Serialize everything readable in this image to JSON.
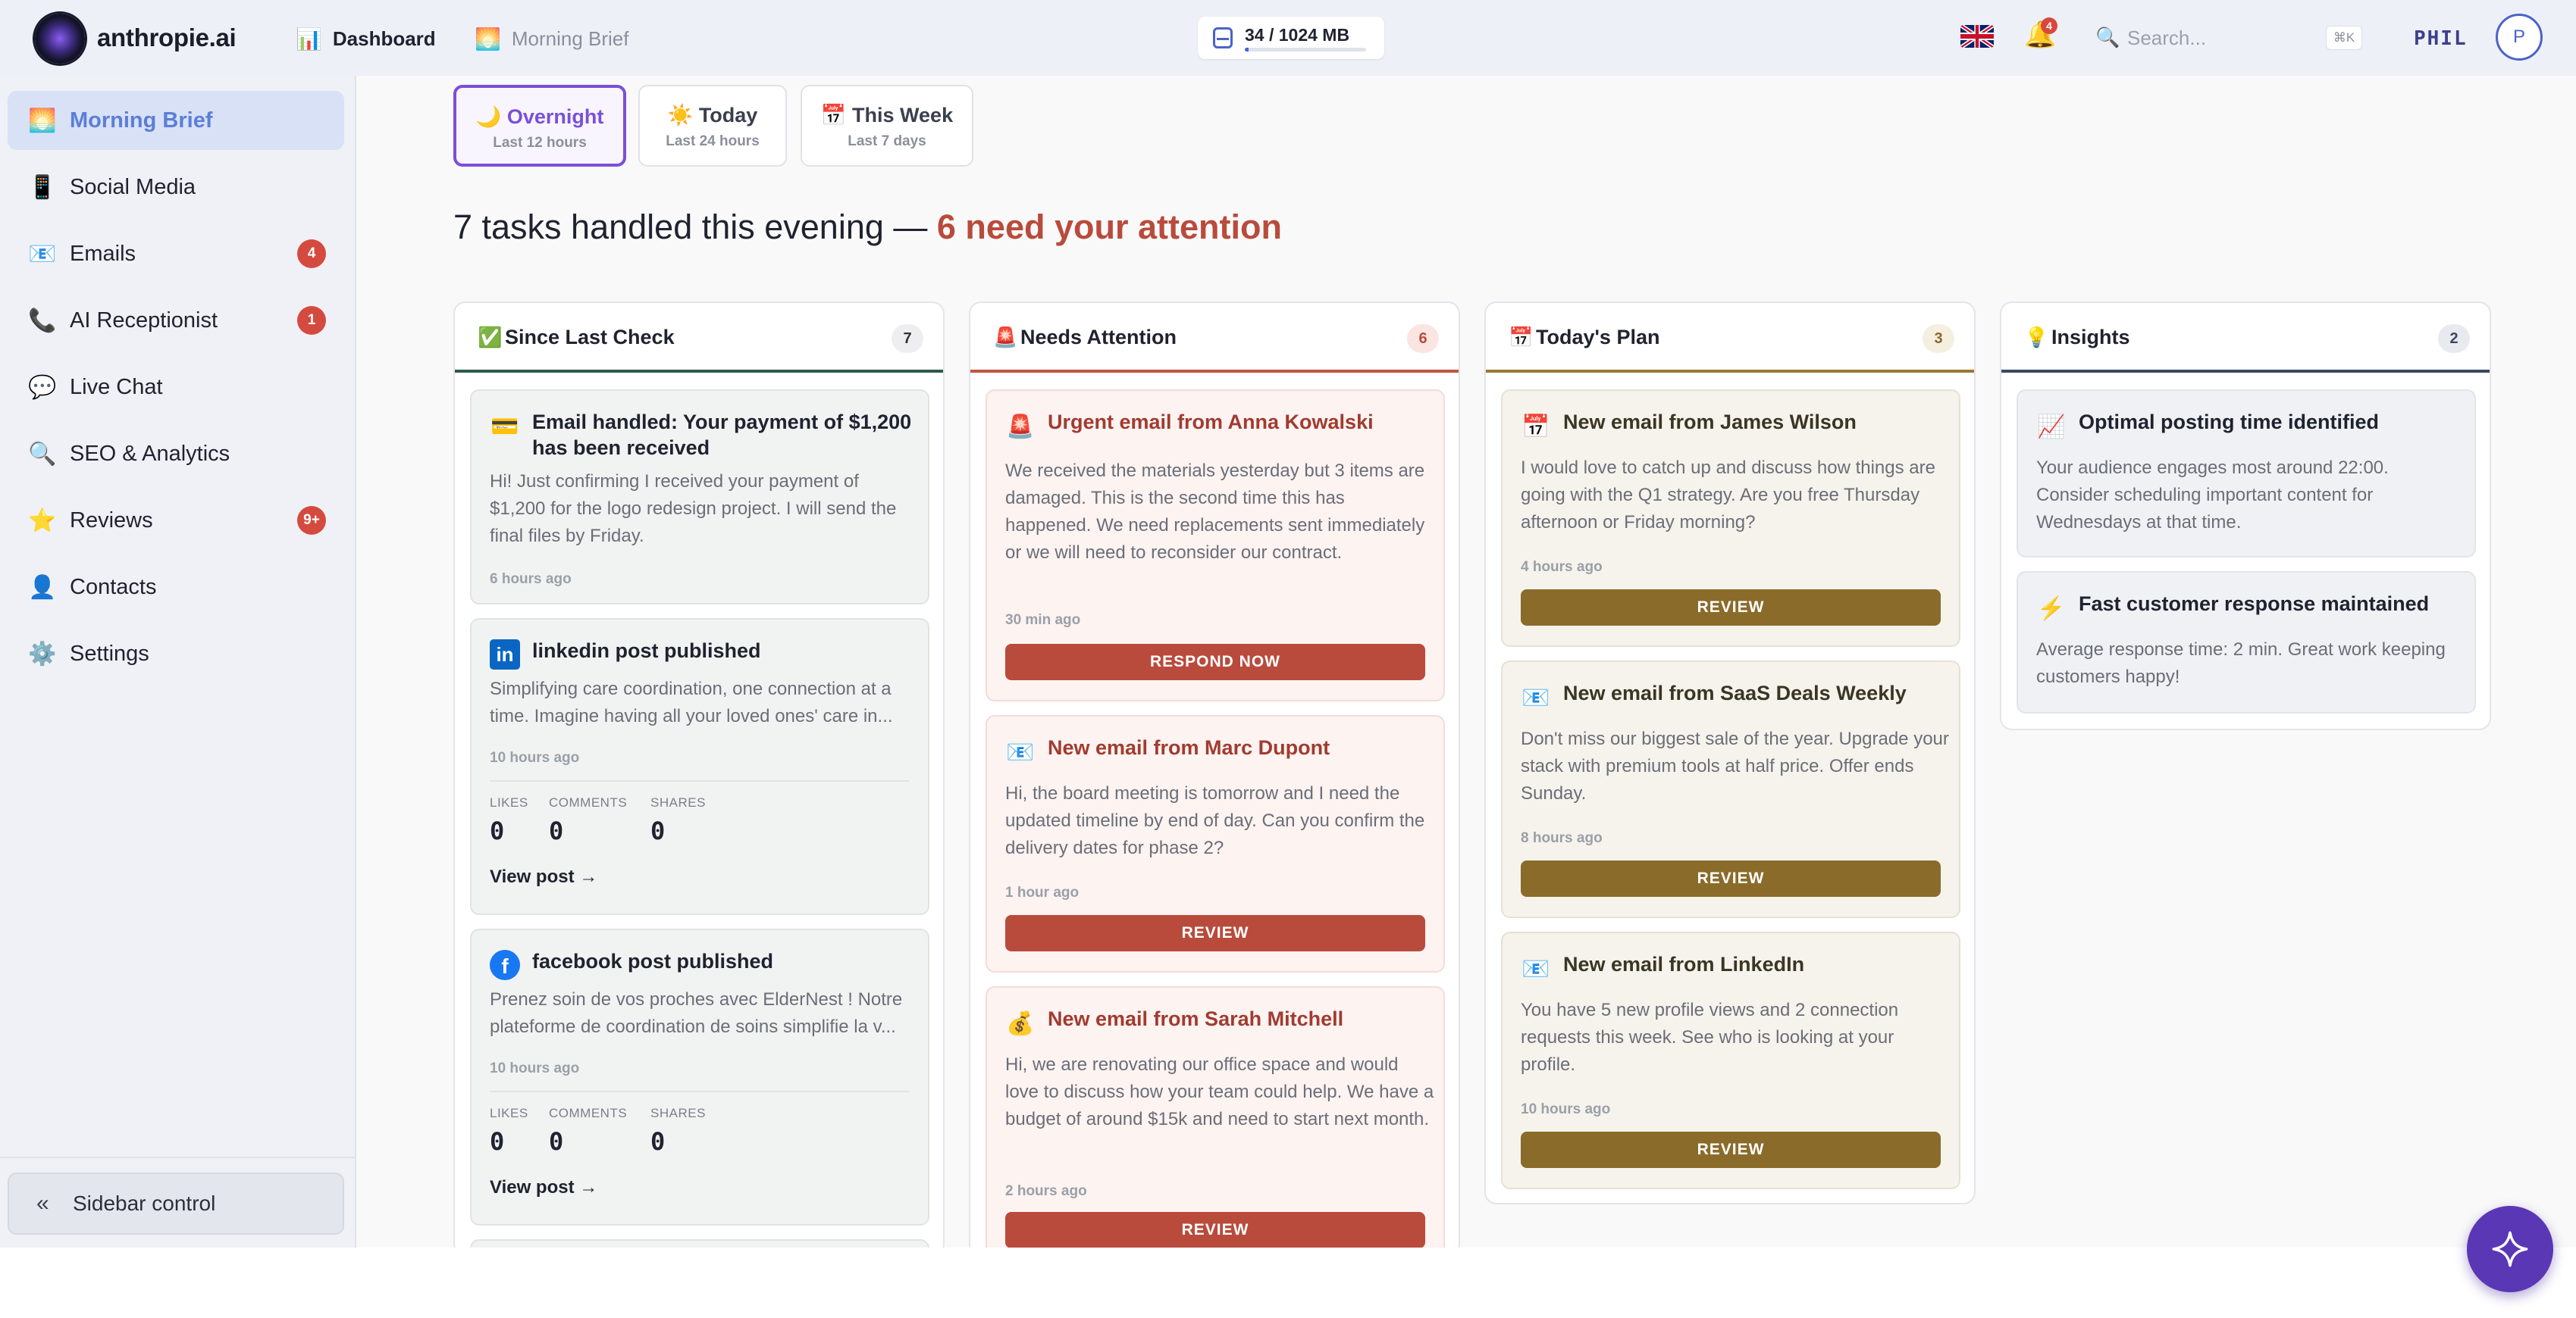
{
  "header": {
    "app_name": "anthropie.ai",
    "nav": [
      {
        "icon": "bar-chart-icon",
        "glyph": "📊",
        "label": "Dashboard"
      },
      {
        "icon": "sunrise-icon",
        "glyph": "🌅",
        "label": "Morning Brief"
      }
    ],
    "storage": {
      "label": "34 / 1024 MB",
      "used_fraction": 0.033
    },
    "notifications_count": "4",
    "search": {
      "placeholder": "Search...",
      "shortcut": "⌘K"
    },
    "user_name": "PHIL",
    "avatar_initial": "P"
  },
  "sidebar": {
    "items": [
      {
        "icon": "sunrise-icon",
        "glyph": "🌅",
        "label": "Morning Brief",
        "active": true,
        "badge": ""
      },
      {
        "icon": "phone-icon",
        "glyph": "📱",
        "label": "Social Media",
        "badge": ""
      },
      {
        "icon": "mail-icon",
        "glyph": "📧",
        "label": "Emails",
        "badge": "4"
      },
      {
        "icon": "telephone-icon",
        "glyph": "📞",
        "label": "AI Receptionist",
        "badge": "1"
      },
      {
        "icon": "chat-icon",
        "glyph": "💬",
        "label": "Live Chat",
        "badge": ""
      },
      {
        "icon": "magnifier-icon",
        "glyph": "🔍",
        "label": "SEO & Analytics",
        "badge": ""
      },
      {
        "icon": "star-icon",
        "glyph": "⭐",
        "label": "Reviews",
        "badge": "9+"
      },
      {
        "icon": "contact-icon",
        "glyph": "👤",
        "label": "Contacts",
        "badge": ""
      },
      {
        "icon": "gear-icon",
        "glyph": "⚙️",
        "label": "Settings",
        "badge": ""
      }
    ],
    "control": {
      "glyph": "«",
      "label": "Sidebar control"
    }
  },
  "time_ranges": [
    {
      "glyph": "🌙",
      "label": "Overnight",
      "sub": "Last 12 hours",
      "active": true
    },
    {
      "glyph": "☀️",
      "label": "Today",
      "sub": "Last 24 hours"
    },
    {
      "glyph": "📅",
      "label": "This Week",
      "sub": "Last 7 days"
    }
  ],
  "headline": {
    "text": "7 tasks handled this evening —",
    "accent": "6 need your attention"
  },
  "columns": {
    "since": {
      "glyph": "✅",
      "title": "Since Last Check",
      "count": "7",
      "cards": [
        {
          "glyph": "💳",
          "title": "Email handled: Your payment of $1,200 has been received",
          "body": "Hi! Just confirming I received your payment of $1,200 for the logo redesign project. I will send the final files by Friday.",
          "time": "6 hours ago"
        },
        {
          "glyph": "in",
          "title": "linkedin post published",
          "body": "Simplifying care coordination, one connection at a time. Imagine having all your loved ones' care in...",
          "time": "10 hours ago",
          "metric_labels": [
            "LIKES",
            "COMMENTS",
            "SHARES"
          ],
          "metric_values": [
            "0",
            "0",
            "0"
          ],
          "link": "View post →"
        },
        {
          "glyph": "f",
          "title": "facebook post published",
          "body": "Prenez soin de vos proches avec ElderNest ! Notre plateforme de coordination de soins simplifie la v...",
          "time": "10 hours ago",
          "metric_labels": [
            "LIKES",
            "COMMENTS",
            "SHARES"
          ],
          "metric_values": [
            "0",
            "0",
            "0"
          ],
          "link": "View post →"
        }
      ]
    },
    "attention": {
      "glyph": "🚨",
      "title": "Needs Attention",
      "count": "6",
      "cards": [
        {
          "glyph": "🚨",
          "title": "Urgent email from Anna Kowalski",
          "body": "We received the materials yesterday but 3 items are damaged. This is the second time this has happened. We need replacements sent immediately or we will need to reconsider our contract.",
          "time": "30 min ago",
          "button": "RESPOND NOW"
        },
        {
          "glyph": "📧",
          "title": "New email from Marc Dupont",
          "body": "Hi, the board meeting is tomorrow and I need the updated timeline by end of day. Can you confirm the delivery dates for phase 2?",
          "time": "1 hour ago",
          "button": "REVIEW"
        },
        {
          "glyph": "💰",
          "title": "New email from Sarah Mitchell",
          "body": "Hi, we are renovating our office space and would love to discuss how your team could help. We have a budget of around $15k and need to start next month.",
          "time": "2 hours ago",
          "button": "REVIEW"
        }
      ]
    },
    "plan": {
      "glyph": "📅",
      "title": "Today's Plan",
      "count": "3",
      "cards": [
        {
          "glyph": "📅",
          "title": "New email from James Wilson",
          "body": "I would love to catch up and discuss how things are going with the Q1 strategy. Are you free Thursday afternoon or Friday morning?",
          "time": "4 hours ago",
          "button": "REVIEW"
        },
        {
          "glyph": "📧",
          "title": "New email from SaaS Deals Weekly",
          "body": "Don't miss our biggest sale of the year. Upgrade your stack with premium tools at half price. Offer ends Sunday.",
          "time": "8 hours ago",
          "button": "REVIEW"
        },
        {
          "glyph": "📧",
          "title": "New email from LinkedIn",
          "body": "You have 5 new profile views and 2 connection requests this week. See who is looking at your profile.",
          "time": "10 hours ago",
          "button": "REVIEW"
        }
      ]
    },
    "insights": {
      "glyph": "💡",
      "title": "Insights",
      "count": "2",
      "cards": [
        {
          "glyph": "📈",
          "title": "Optimal posting time identified",
          "body": "Your audience engages most around 22:00. Consider scheduling important content for Wednesdays at that time."
        },
        {
          "glyph": "⚡",
          "title": "Fast customer response maintained",
          "body": "Average response time: 2 min. Great work keeping customers happy!"
        }
      ]
    }
  },
  "colors": {
    "accent": "#7a4fd8",
    "brand_blue": "#4b63c9",
    "urgent": "#b94b3c",
    "plan": "#8a6b2a",
    "badge": "#d54a3e"
  }
}
